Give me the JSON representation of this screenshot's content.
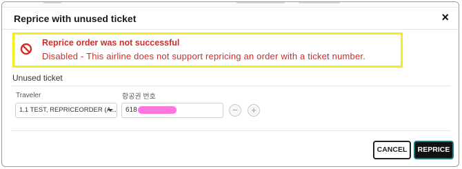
{
  "dialog": {
    "title": "Reprice with unused ticket",
    "close_label": "×"
  },
  "alert": {
    "icon": "prohibited-icon",
    "title": "Reprice order was not successful",
    "message": "Disabled - This airline does not support repricing an order with a ticket number.",
    "colors": {
      "text": "#d42a2a",
      "highlight_border": "#f4ec1c"
    }
  },
  "unused_ticket": {
    "section_label": "Unused ticket",
    "traveler": {
      "label": "Traveler",
      "value": "1.1 TEST, REPRICEORDER (A..."
    },
    "ticket_number": {
      "label": "항공권 번호",
      "value_visible_prefix": "618"
    },
    "remove_label": "−",
    "add_label": "+"
  },
  "footer": {
    "cancel_label": "CANCEL",
    "reprice_label": "REPRICE"
  },
  "colors": {
    "accent_border": "#1a7a86",
    "primary_button": "#111111"
  }
}
